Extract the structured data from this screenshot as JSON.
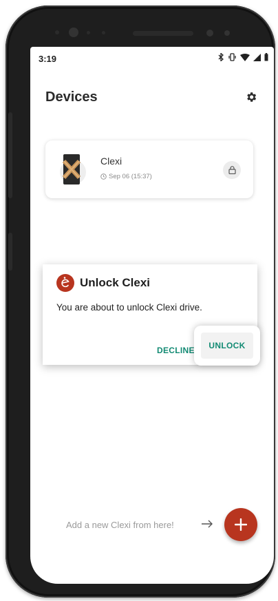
{
  "status_bar": {
    "time": "3:19",
    "icons": [
      "bluetooth-icon",
      "vibrate-icon",
      "wifi-icon",
      "signal-icon",
      "battery-icon"
    ]
  },
  "header": {
    "title": "Devices",
    "settings_icon": "gear-icon"
  },
  "device_card": {
    "name": "Clexi",
    "last_seen": "Sep 06 (15:37)",
    "lock_icon": "lock-icon"
  },
  "dialog": {
    "title": "Unlock Clexi",
    "message": "You are about to unlock Clexi drive.",
    "decline_label": "DECLINE",
    "unlock_label": "UNLOCK"
  },
  "footer": {
    "hint": "Add a new Clexi from here!",
    "fab_icon": "plus-icon"
  },
  "colors": {
    "accent": "#b8351f",
    "action_text": "#128a73"
  }
}
